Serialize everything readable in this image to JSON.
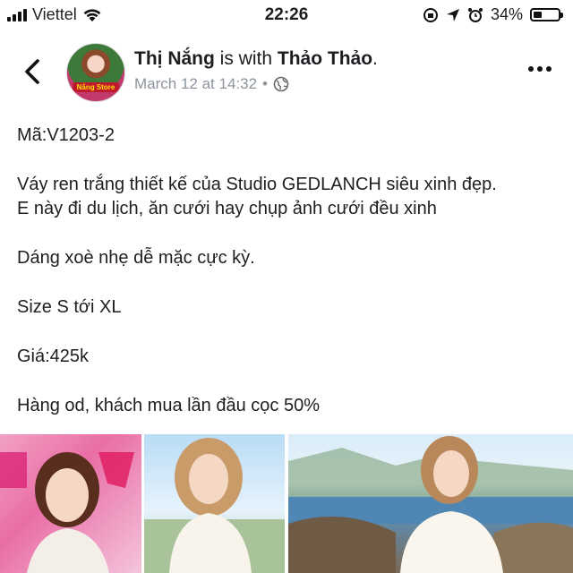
{
  "status_bar": {
    "carrier": "Viettel",
    "time": "22:26",
    "battery_percent": "34%",
    "battery_level": 0.34,
    "icons": [
      "signal-icon",
      "wifi-icon",
      "orientation-lock-icon",
      "location-icon",
      "alarm-icon",
      "battery-icon"
    ]
  },
  "header": {
    "author": "Thị Nắng",
    "with_text": "is with",
    "tagged": "Thảo Thảo",
    "period": ".",
    "date": "March 12 at 14:32",
    "separator": "•",
    "avatar_label": "Nắng Store"
  },
  "post": {
    "lines": [
      "Mã:V1203-2",
      "Váy ren trắng thiết kế của Studio GEDLANCH siêu xinh đẹp.",
      "E này đi du lịch, ăn cưới hay chụp ảnh cưới đều xinh",
      "Dáng xoè nhẹ dễ mặc cực kỳ.",
      "Size S tới XL",
      "Giá:425k",
      "Hàng od, khách mua lần đầu cọc 50%"
    ]
  },
  "colors": {
    "text": "#1c1e21",
    "meta": "#8d949e"
  }
}
